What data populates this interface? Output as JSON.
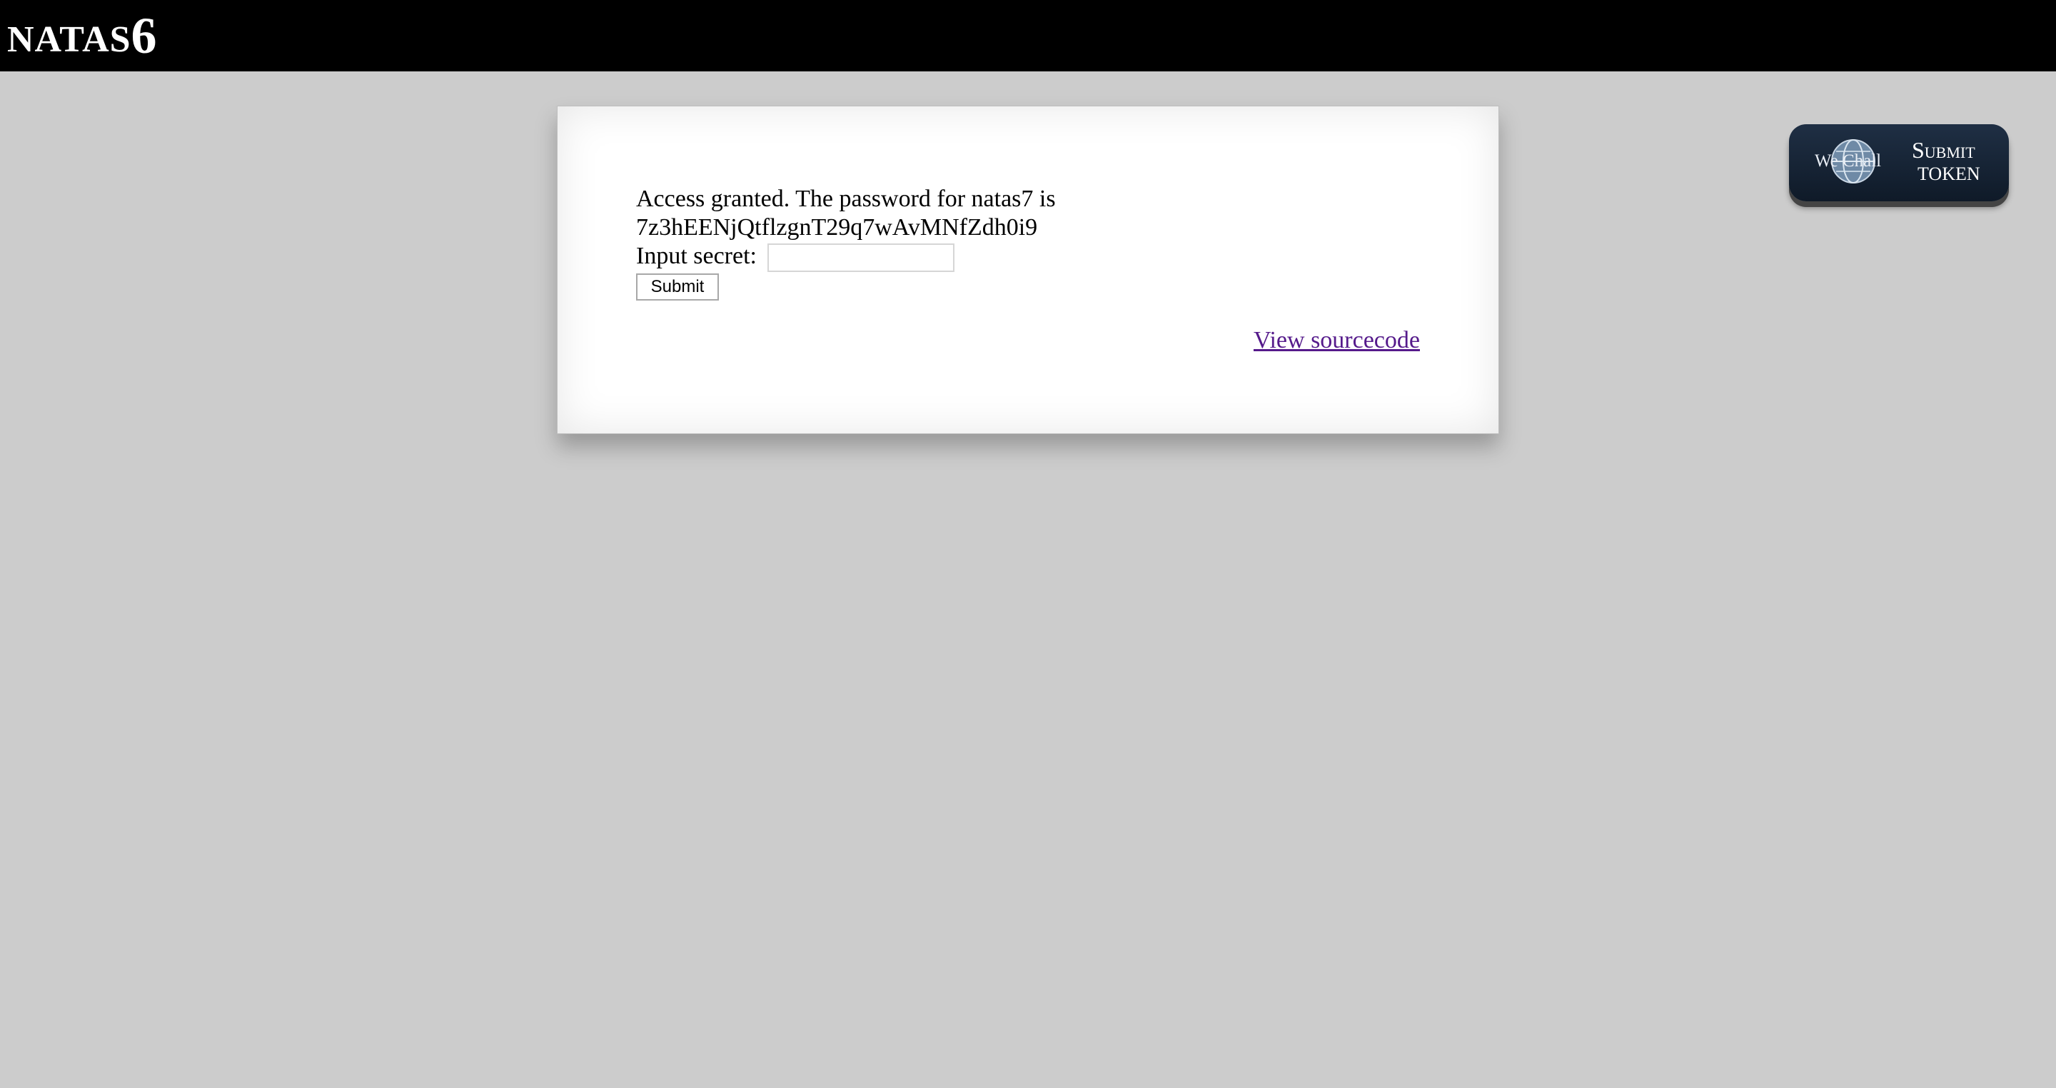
{
  "header": {
    "title_prefix": "NATAS",
    "title_number": "6"
  },
  "content": {
    "message_line1": "Access granted. The password for natas7 is",
    "message_line2": "7z3hEENjQtflzgnT29q7wAvMNfZdh0i9",
    "input_label": "Input secret:",
    "input_value": "",
    "submit_label": "Submit",
    "view_source_link": "View sourcecode"
  },
  "wechall": {
    "brand": "We Chall",
    "submit_line1": "Submit",
    "submit_line2": "TOKEN"
  },
  "colors": {
    "page_background": "#cccccc",
    "header_background": "#000000",
    "link_visited": "#551a8b",
    "wechall_bg": "#1f2f44"
  },
  "icons": {
    "wechall_logo": "globe-icon"
  }
}
